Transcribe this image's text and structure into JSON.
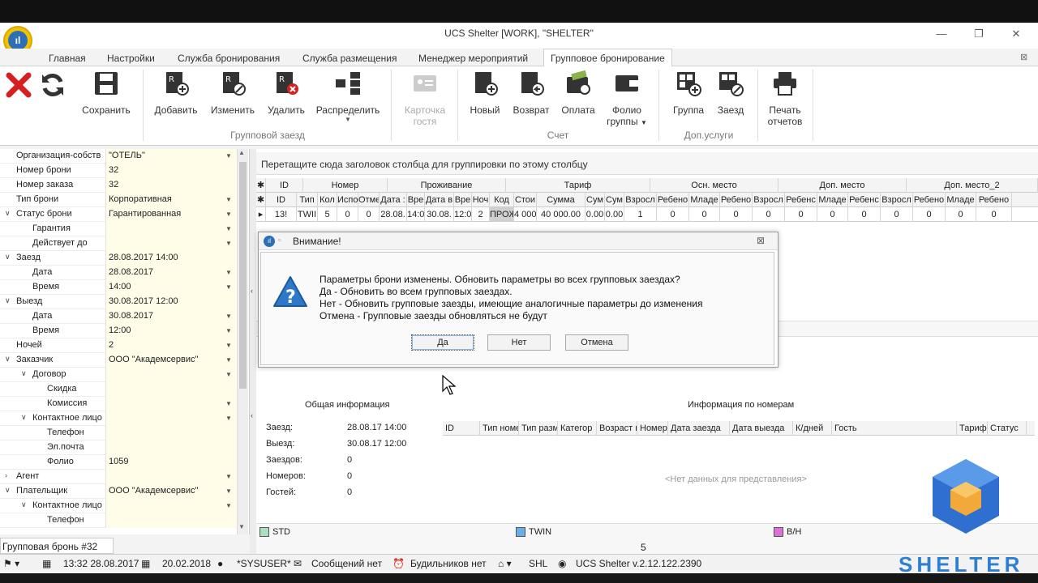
{
  "window": {
    "title": "UCS Shelter [WORK], \"SHELTER\"",
    "app_logo": "ıl"
  },
  "tabs": [
    {
      "label": "Главная"
    },
    {
      "label": "Настройки"
    },
    {
      "label": "Служба бронирования"
    },
    {
      "label": "Служба размещения"
    },
    {
      "label": "Менеджер мероприятий"
    },
    {
      "label": "Групповое бронирование"
    }
  ],
  "ribbon": {
    "save": "Сохранить",
    "add": "Добавить",
    "edit": "Изменить",
    "delete": "Удалить",
    "distribute": "Распределить",
    "group_checkin_label": "Групповой заезд",
    "guest_card_1": "Карточка",
    "guest_card_2": "гостя",
    "new": "Новый",
    "return": "Возврат",
    "payment": "Оплата",
    "folio_1": "Фолио",
    "folio_2": "группы",
    "account_label": "Счет",
    "group": "Группа",
    "checkin": "Заезд",
    "extra_label": "Доп.услуги",
    "print_1": "Печать",
    "print_2": "отчетов"
  },
  "props": [
    {
      "label": "Организация-собств",
      "value": "\"ОТЕЛЬ\"",
      "indent": 0,
      "dd": true
    },
    {
      "label": "Номер брони",
      "value": "32",
      "indent": 0
    },
    {
      "label": "Номер заказа",
      "value": "32",
      "indent": 0
    },
    {
      "label": "Тип брони",
      "value": "Корпоративная",
      "indent": 0,
      "dd": true
    },
    {
      "label": "Статус брони",
      "value": "Гарантированная",
      "indent": 0,
      "exp": "v",
      "dd": true
    },
    {
      "label": "Гарантия",
      "value": "",
      "indent": 1,
      "dd": true
    },
    {
      "label": "Действует до",
      "value": "",
      "indent": 1,
      "dd": true
    },
    {
      "label": "Заезд",
      "value": "28.08.2017 14:00",
      "indent": 0,
      "exp": "v"
    },
    {
      "label": "Дата",
      "value": "28.08.2017",
      "indent": 1,
      "dd": true
    },
    {
      "label": "Время",
      "value": "14:00",
      "indent": 1,
      "dd": true
    },
    {
      "label": "Выезд",
      "value": "30.08.2017 12:00",
      "indent": 0,
      "exp": "v"
    },
    {
      "label": "Дата",
      "value": "30.08.2017",
      "indent": 1,
      "dd": true
    },
    {
      "label": "Время",
      "value": "12:00",
      "indent": 1,
      "dd": true
    },
    {
      "label": "Ночей",
      "value": "2",
      "indent": 0,
      "dd": true
    },
    {
      "label": "Заказчик",
      "value": "ООО \"Академсервис\"",
      "indent": 0,
      "exp": "v",
      "dd": true
    },
    {
      "label": "Договор",
      "value": "",
      "indent": 1,
      "exp": "v",
      "dd": true
    },
    {
      "label": "Скидка",
      "value": "",
      "indent": 2
    },
    {
      "label": "Комиссия",
      "value": "",
      "indent": 2,
      "dd": true
    },
    {
      "label": "Контактное лицо",
      "value": "",
      "indent": 1,
      "exp": "v",
      "dd": true
    },
    {
      "label": "Телефон",
      "value": "",
      "indent": 2
    },
    {
      "label": "Эл.почта",
      "value": "",
      "indent": 2
    },
    {
      "label": "Фолио",
      "value": "1059",
      "indent": 2
    },
    {
      "label": "Агент",
      "value": "",
      "indent": 0,
      "exp": ">",
      "dd": true
    },
    {
      "label": "Плательщик",
      "value": "ООО \"Академсервис\"",
      "indent": 0,
      "exp": "v",
      "dd": true
    },
    {
      "label": "Контактное лицо",
      "value": "",
      "indent": 1,
      "exp": "v",
      "dd": true
    },
    {
      "label": "Телефон",
      "value": "",
      "indent": 2
    }
  ],
  "group_caption": "Групповая бронь #32",
  "grid": {
    "drag_hint": "Перетащите сюда заголовок столбца для группировки по этому столбцу",
    "bands": [
      "ID",
      "Номер",
      "Проживание",
      "Тариф",
      "Осн. место",
      "Доп. место",
      "Доп. место_2"
    ],
    "columns": [
      "ID",
      "Тип",
      "Кол",
      "Испо",
      "Отме",
      "Дата :",
      "Вре",
      "Дата в",
      "Вре",
      "Ноч",
      "Код",
      "Стои",
      "Сумма",
      "Сум",
      "Сум",
      "Взросл",
      "Ребено",
      "Младе",
      "Ребено",
      "Взросл",
      "Ребенс",
      "Младе",
      "Ребенс",
      "Взросл",
      "Ребено",
      "Младе",
      "Ребено"
    ],
    "row": [
      "13!",
      "TWII",
      "5",
      "0",
      "0",
      "28.08.",
      "14:0",
      "30.08.",
      "12:0",
      "2",
      "ПРОЖ",
      "4 000",
      "40 000.00",
      "0.00",
      "0.00",
      "1",
      "0",
      "0",
      "0",
      "0",
      "0",
      "0",
      "0",
      "0",
      "0",
      "0",
      "0"
    ]
  },
  "dialog": {
    "title": "Внимание!",
    "line1": "Параметры брони изменены. Обновить параметры во всех групповых заездах?",
    "line2": "Да - Обновить во всем групповых заездах.",
    "line3": "Нет - Обновить групповые заезды, имеющие аналогичные параметры до изменения",
    "line4": "Отмена - Групповые заезды обновляться не будут",
    "yes": "Да",
    "no": "Нет",
    "cancel": "Отмена"
  },
  "info": {
    "general_title": "Общая информация",
    "rooms_title": "Информация по номерам",
    "arrival_label": "Заезд:",
    "arrival_value": "28.08.17 14:00",
    "departure_label": "Выезд:",
    "departure_value": "30.08.17 12:00",
    "checkins_label": "Заездов:",
    "checkins_value": "0",
    "rooms_label": "Номеров:",
    "rooms_value": "0",
    "guests_label": "Гостей:",
    "guests_value": "0",
    "room_cols": [
      "ID",
      "Тип номе",
      "Тип разм",
      "Категор",
      "Возраст г",
      "Номер",
      "Дата заезда",
      "Дата выезда",
      "К/дней",
      "Гость",
      "Тариф",
      "Статус"
    ],
    "no_data": "<Нет данных для представления>"
  },
  "legend": {
    "items": [
      {
        "label": "STD",
        "color": "#a8e0c0"
      },
      {
        "label": "TWIN",
        "color": "#6aaee8"
      },
      {
        "label": "B/H",
        "color": "#e070d8"
      }
    ],
    "count": "5"
  },
  "status": {
    "datetime": "13:32 28.08.2017",
    "date2": "20.02.2018",
    "user": "*SYSUSER*",
    "messages": "Сообщений нет",
    "alarms": "Будильников нет",
    "hotel": "SHL",
    "version": "UCS Shelter v.2.12.122.2390"
  },
  "brand": "SHELTER"
}
